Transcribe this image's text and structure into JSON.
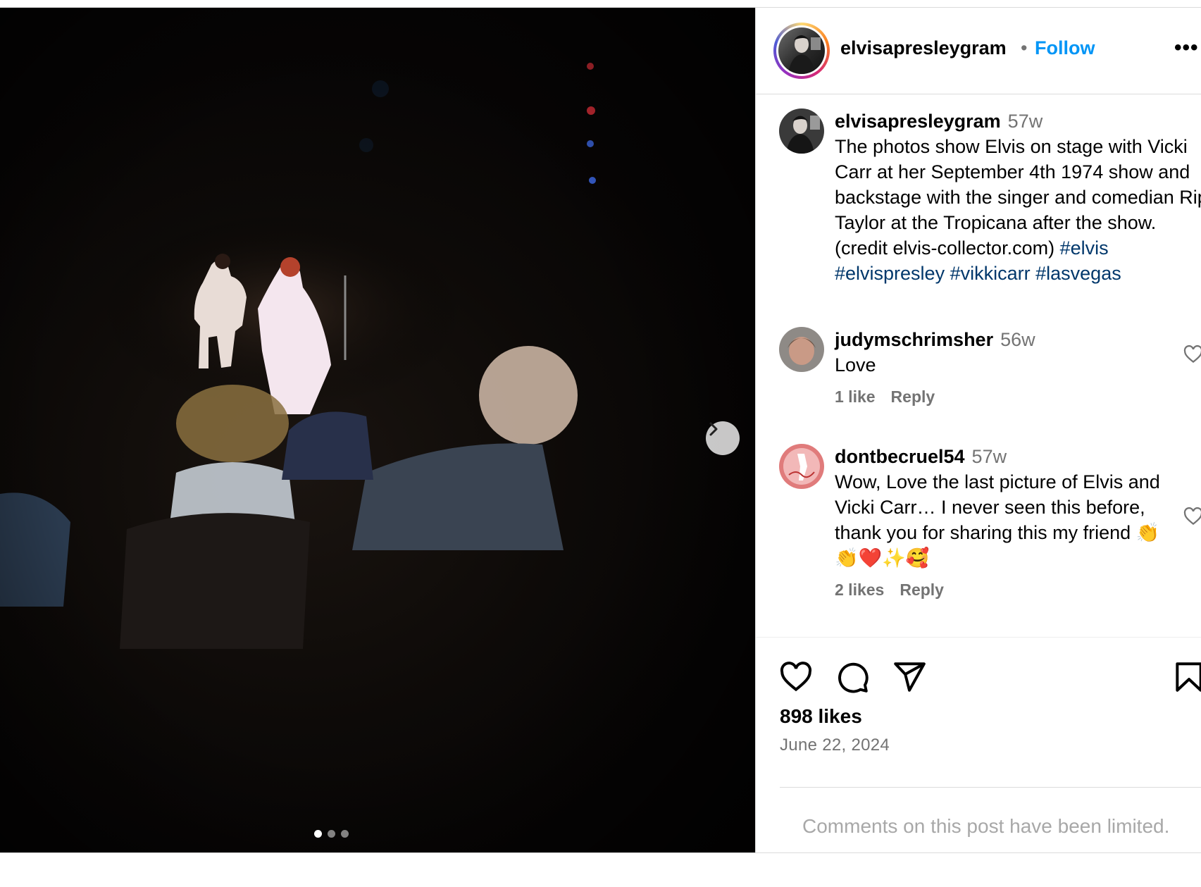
{
  "post": {
    "author": "elvisapresleygram",
    "follow_label": "Follow",
    "separator": "•",
    "more_label": "•••",
    "caption": {
      "time": "57w",
      "text": "The photos show Elvis on stage with Vicki Carr at her September 4th 1974 show and backstage with the singer and comedian Rip Taylor at the Tropicana after the show. (credit elvis-collector.com)",
      "hashtags": [
        "#elvis",
        "#elvispresley",
        "#vikkicarr",
        "#lasvegas"
      ]
    },
    "likes": "898 likes",
    "date": "June 22, 2024",
    "comments_limited": "Comments on this post have been limited.",
    "carousel": {
      "slides": 3,
      "active_index": 0
    }
  },
  "comments": [
    {
      "user": "judymschrimsher",
      "time": "56w",
      "text": "Love",
      "likes": "1 like",
      "reply": "Reply"
    },
    {
      "user": "dontbecruel54",
      "time": "57w",
      "text": "Wow, Love the last picture of Elvis and Vicki Carr… I never seen this before, thank you for sharing this my friend 👏👏❤️✨🥰",
      "likes": "2 likes",
      "reply": "Reply"
    }
  ],
  "icons": {
    "next": "chevron-right-icon",
    "like": "heart-icon",
    "comment": "comment-icon",
    "share": "send-icon",
    "save": "bookmark-icon"
  },
  "colors": {
    "link": "#0095f6",
    "hashtag": "#00376b",
    "muted": "#737373",
    "border": "#dbdbdb"
  }
}
